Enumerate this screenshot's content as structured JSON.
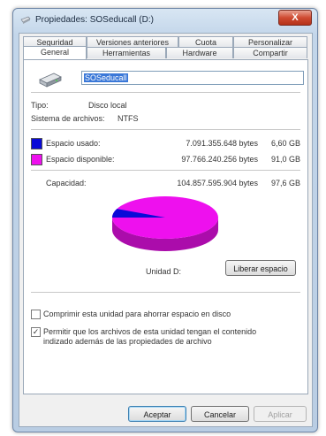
{
  "window": {
    "title": "Propiedades: SOSeducall (D:)",
    "close_label": "X"
  },
  "tabs": {
    "row1": [
      {
        "label": "Seguridad"
      },
      {
        "label": "Versiones anteriores"
      },
      {
        "label": "Cuota"
      },
      {
        "label": "Personalizar"
      }
    ],
    "row2": [
      {
        "label": "General",
        "active": true
      },
      {
        "label": "Herramientas"
      },
      {
        "label": "Hardware"
      },
      {
        "label": "Compartir"
      }
    ]
  },
  "general": {
    "volume_name": "SOSeducall",
    "type_label": "Tipo:",
    "type_value": "Disco local",
    "fs_label": "Sistema de archivos:",
    "fs_value": "NTFS",
    "used": {
      "label": "Espacio usado:",
      "bytes": "7.091.355.648 bytes",
      "size": "6,60 GB",
      "color": "#0a0ad8"
    },
    "free": {
      "label": "Espacio disponible:",
      "bytes": "97.766.240.256 bytes",
      "size": "91,0 GB",
      "color": "#ee10ee"
    },
    "capacity": {
      "label": "Capacidad:",
      "bytes": "104.857.595.904 bytes",
      "size": "97,6 GB"
    },
    "used_fraction": 0.0676,
    "drive_label": "Unidad D:",
    "cleanup_button": "Liberar espacio",
    "compress_label": "Comprimir esta unidad para ahorrar espacio en disco",
    "compress_checked": false,
    "index_label_line1": "Permitir que los archivos de esta unidad tengan el contenido",
    "index_label_line2": "indizado además de las propiedades de archivo",
    "index_checked": true
  },
  "buttons": {
    "ok": "Aceptar",
    "cancel": "Cancelar",
    "apply": "Aplicar"
  }
}
